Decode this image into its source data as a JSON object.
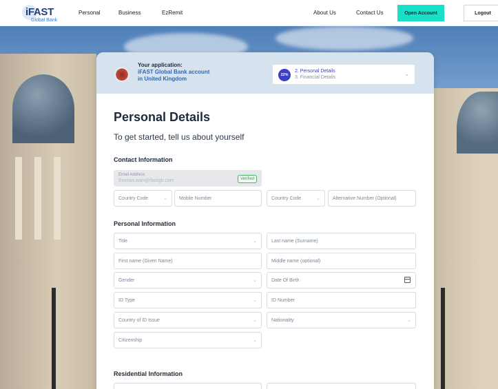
{
  "brand": {
    "logo_main": "iFAST",
    "logo_sub": "Global Bank"
  },
  "nav": {
    "personal": "Personal",
    "business": "Business",
    "ezremit": "EzRemit",
    "about": "About Us",
    "contact": "Contact Us",
    "open_account": "Open Account",
    "logout": "Logout"
  },
  "application": {
    "title": "Your application:",
    "line1": "iFAST Global Bank account",
    "line2": "in United Kingdom",
    "progress_percent": "22%",
    "current_step": "2. Personal Details",
    "next_step": "3. Financial Details"
  },
  "form": {
    "heading": "Personal Details",
    "subheading": "To get started, tell us about yourself",
    "contact_section": "Contact Information",
    "email_label": "Email Address",
    "email_value": "thomas.wan@ifastgb.com",
    "verified": "Verified",
    "country_code": "Country Code",
    "mobile": "Mobile Number",
    "country_code_2": "Country Code",
    "alt_number": "Alternative Number (Optional)",
    "personal_section": "Personal Information",
    "title": "Title",
    "last_name": "Last name (Surname)",
    "first_name": "First name (Given Name)",
    "middle_name": "Middle name (optional)",
    "gender": "Gender",
    "dob": "Date Of Birth",
    "id_type": "ID Type",
    "id_number": "ID Number",
    "country_id_issue": "Country of ID Issue",
    "nationality": "Nationality",
    "citizenship": "Citizenship",
    "residential_section": "Residential Information"
  }
}
